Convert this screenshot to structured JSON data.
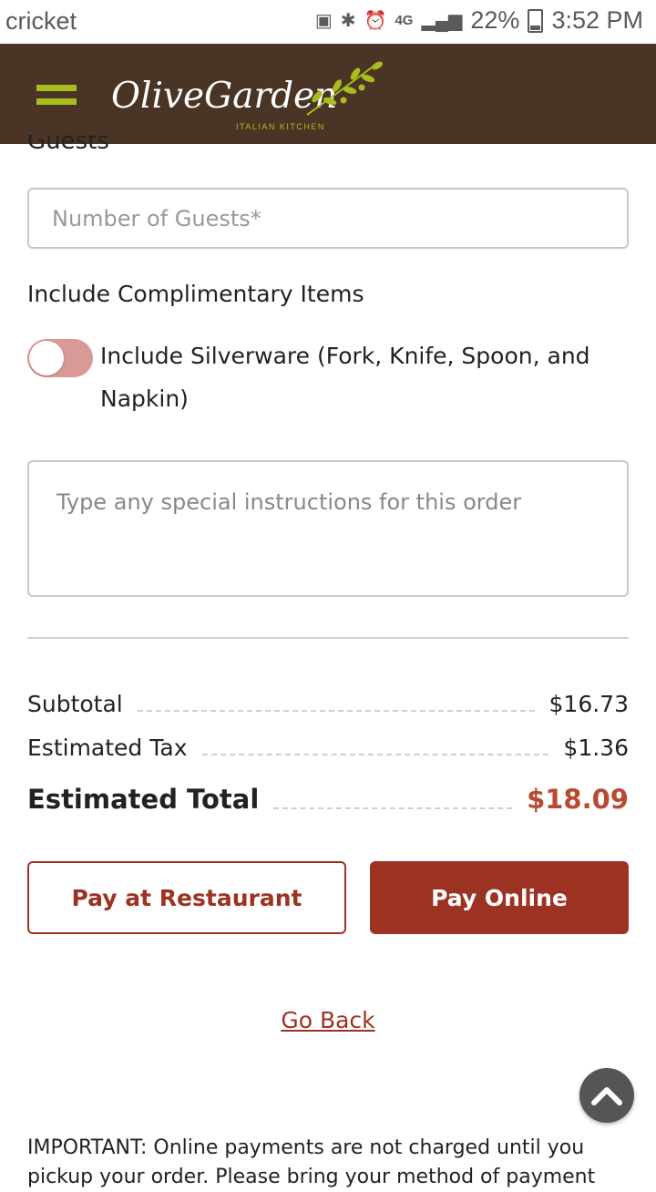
{
  "status_bar": {
    "carrier": "cricket",
    "network": "4G",
    "battery": "22%",
    "time": "3:52 PM"
  },
  "header": {
    "brand_main": "OliveGarden",
    "brand_sub": "ITALIAN KITCHEN"
  },
  "form": {
    "guests_label": "Guests",
    "guests_placeholder": "Number of Guests*",
    "complimentary_title": "Include Complimentary Items",
    "silverware_label": "Include Silverware (Fork, Knife, Spoon, and Napkin)",
    "instructions_placeholder": "Type any special instructions for this order"
  },
  "summary": {
    "subtotal_label": "Subtotal",
    "subtotal_value": "$16.73",
    "tax_label": "Estimated Tax",
    "tax_value": "$1.36",
    "total_label": "Estimated Total",
    "total_value": "$18.09"
  },
  "actions": {
    "pay_restaurant": "Pay at Restaurant",
    "pay_online": "Pay Online",
    "go_back": "Go Back"
  },
  "footer": {
    "important_note": "IMPORTANT: Online payments are not charged until you pickup your order. Please bring your method of payment"
  },
  "colors": {
    "header_bg": "#4a3425",
    "accent_red": "#9c3322",
    "menu_green": "#a8bd1e",
    "toggle_off": "#d99a96"
  }
}
